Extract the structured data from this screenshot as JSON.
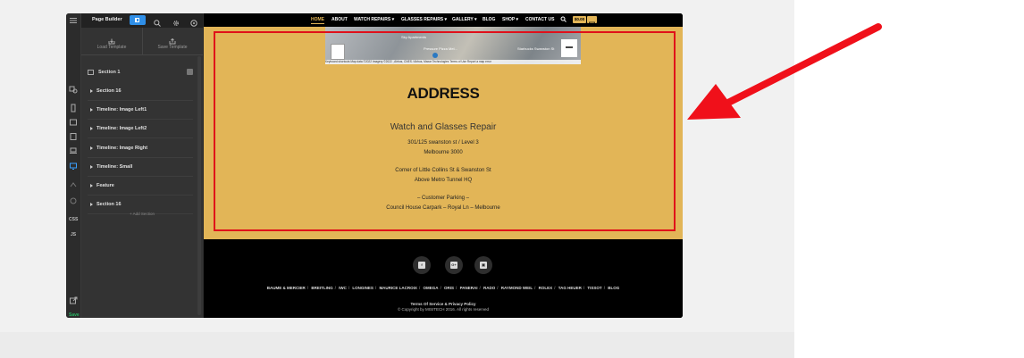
{
  "builder": {
    "title": "Page Builder",
    "load_template": "Load Template",
    "save_template": "Save Template",
    "section_header": "Section 1",
    "rows": [
      "Section 16",
      "Timeline: Image Left1",
      "Timeline: Image Left2",
      "Timeline: Image Right",
      "Timeline: Small",
      "Feature",
      "Section 16"
    ],
    "add_section": "+ Add Section",
    "iconbar": {
      "css": "CSS",
      "js": "JS",
      "save": "Save"
    }
  },
  "nav": {
    "items": [
      "HOME",
      "ABOUT",
      "WATCH REPAIRS ▾",
      "GLASSES REPAIRS ▾",
      "GALLERY ▾",
      "BLOG",
      "SHOP ▾",
      "CONTACT US"
    ],
    "cart_total": "$0.00"
  },
  "map": {
    "footer_text": "Keyboard shortcuts   Map data ©2022 Imagery ©2022 , Airbus, CNES / Airbus, Maxar Technologies   Terms of Use   Report a map error",
    "labels": [
      "Sky Apartments",
      "Pressure Pizza Mel...",
      "Starbucks Swanston St"
    ]
  },
  "address": {
    "title": "ADDRESS",
    "subtitle": "Watch and Glasses Repair",
    "line1": "301/125 swanston st / Level 3",
    "line2": "Melbourne 3000",
    "line3": "Corner of Little Collins St & Swanston St",
    "line4": "Above Metro Tunnel HQ",
    "line5": "– Customer Parking –",
    "line6": "Council House Carpark – Royal Ln – Melbourne"
  },
  "footer": {
    "social": [
      "f",
      "G+",
      "▣"
    ],
    "brands": [
      "BAUME & MERCIER",
      "BREITLING",
      "IWC",
      "LONGINES",
      "MAURICE LACROIX",
      "OMEGA",
      "ORIS",
      "PANERAI",
      "RADO",
      "RAYMOND WEIL",
      "ROLEX",
      "TAG HEUER",
      "TISSOT",
      "BLOG"
    ],
    "terms": "Terms Of Service & Privacy Policy",
    "copyright": "© Copyright by MISITECH 2016. All rights reserved"
  },
  "colors": {
    "accent": "#e2b557",
    "highlight": "#e0101a",
    "toggle": "#2f8fe8"
  }
}
